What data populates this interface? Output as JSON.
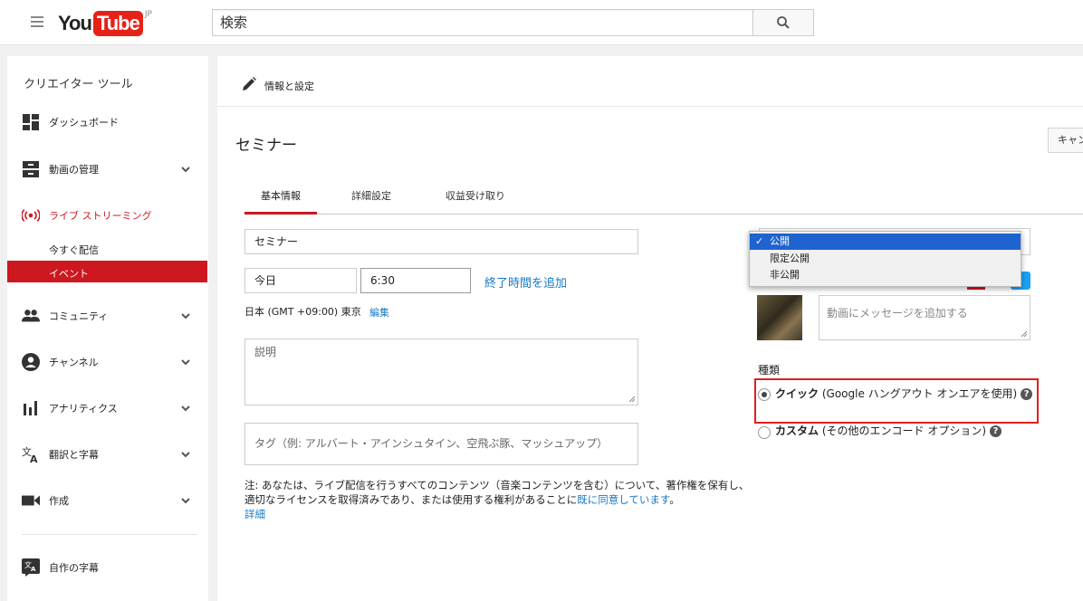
{
  "header": {
    "logo": {
      "you": "You",
      "tube": "Tube",
      "region": "JP"
    },
    "search": {
      "value": "検索"
    },
    "icons": {
      "menu": "hamburger-icon",
      "search": "search-icon"
    }
  },
  "sidebar": {
    "title": "クリエイター ツール",
    "items": [
      {
        "label": "ダッシュボード",
        "icon": "dashboard-icon"
      },
      {
        "label": "動画の管理",
        "icon": "video-manager-icon"
      },
      {
        "label": "ライブ ストリーミング",
        "icon": "live-streaming-icon"
      },
      {
        "label": "コミュニティ",
        "icon": "community-icon"
      },
      {
        "label": "チャンネル",
        "icon": "channel-icon"
      },
      {
        "label": "アナリティクス",
        "icon": "analytics-icon"
      },
      {
        "label": "翻訳と字幕",
        "icon": "translate-icon"
      },
      {
        "label": "作成",
        "icon": "create-icon"
      },
      {
        "label": "自作の字幕",
        "icon": "subtitles-icon"
      }
    ],
    "live_sub": [
      {
        "label": "今すぐ配信"
      },
      {
        "label": "イベント"
      }
    ],
    "accent": "#cc181e"
  },
  "main": {
    "section_label": "情報と設定",
    "page_title": "セミナー",
    "cancel_label": "キャンセル",
    "tabs": [
      {
        "label": "基本情報"
      },
      {
        "label": "詳細設定"
      },
      {
        "label": "収益受け取り"
      }
    ],
    "form": {
      "title_value": "セミナー",
      "date_value": "今日",
      "time_value": "6:30",
      "add_end_time": "終了時間を追加",
      "timezone": "日本 (GMT +09:00) 東京",
      "edit_link": "編集",
      "description_placeholder": "説明",
      "tags_placeholder": "タグ（例: アルバート・アインシュタイン、空飛ぶ豚、マッシュアップ）"
    },
    "note": {
      "text": "注: あなたは、ライブ配信を行うすべてのコンテンツ（音楽コンテンツを含む）について、著作権を保有し、適切なライセンスを取得済みであり、または使用する権利があることに",
      "agree_link": "既に同意しています",
      "period": "。",
      "details_link": "詳細"
    },
    "privacy": {
      "options": [
        "公開",
        "限定公開",
        "非公開"
      ],
      "selected": "公開"
    },
    "message_placeholder": "動画にメッセージを追加する",
    "type": {
      "label": "種類",
      "quick_label": "クイック",
      "quick_detail": "(Google ハングアウト オンエアを使用)",
      "custom_label": "カスタム",
      "custom_detail": "(その他のエンコード オプション)"
    }
  }
}
